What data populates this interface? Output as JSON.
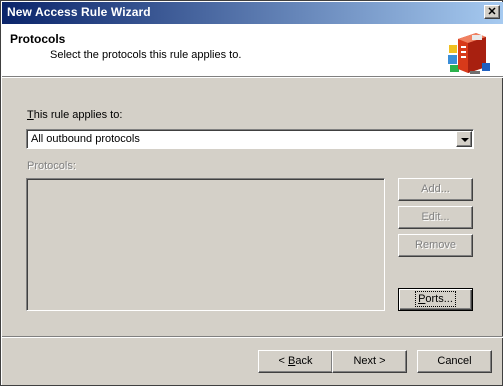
{
  "window": {
    "title": "New Access Rule Wizard"
  },
  "header": {
    "title": "Protocols",
    "subtitle": "Select the protocols this rule applies to.",
    "icon": "firewall-server-icon"
  },
  "rule_applies": {
    "label_prefix": "T",
    "label_rest": "his rule applies to:",
    "selected": "All outbound protocols"
  },
  "protocols": {
    "label": "Protocols:",
    "items": []
  },
  "side_buttons": {
    "add": "Add...",
    "edit": "Edit...",
    "remove": "Remove",
    "ports_prefix": "P",
    "ports_rest": "orts..."
  },
  "footer": {
    "back_lt": "< ",
    "back_u": "B",
    "back_rest": "ack",
    "next": "Next >",
    "cancel": "Cancel"
  },
  "colors": {
    "title_bar_start": "#0a246a",
    "title_bar_end": "#a6caf0",
    "dialog_face": "#d4d0c8",
    "header_bg": "#ffffff"
  }
}
